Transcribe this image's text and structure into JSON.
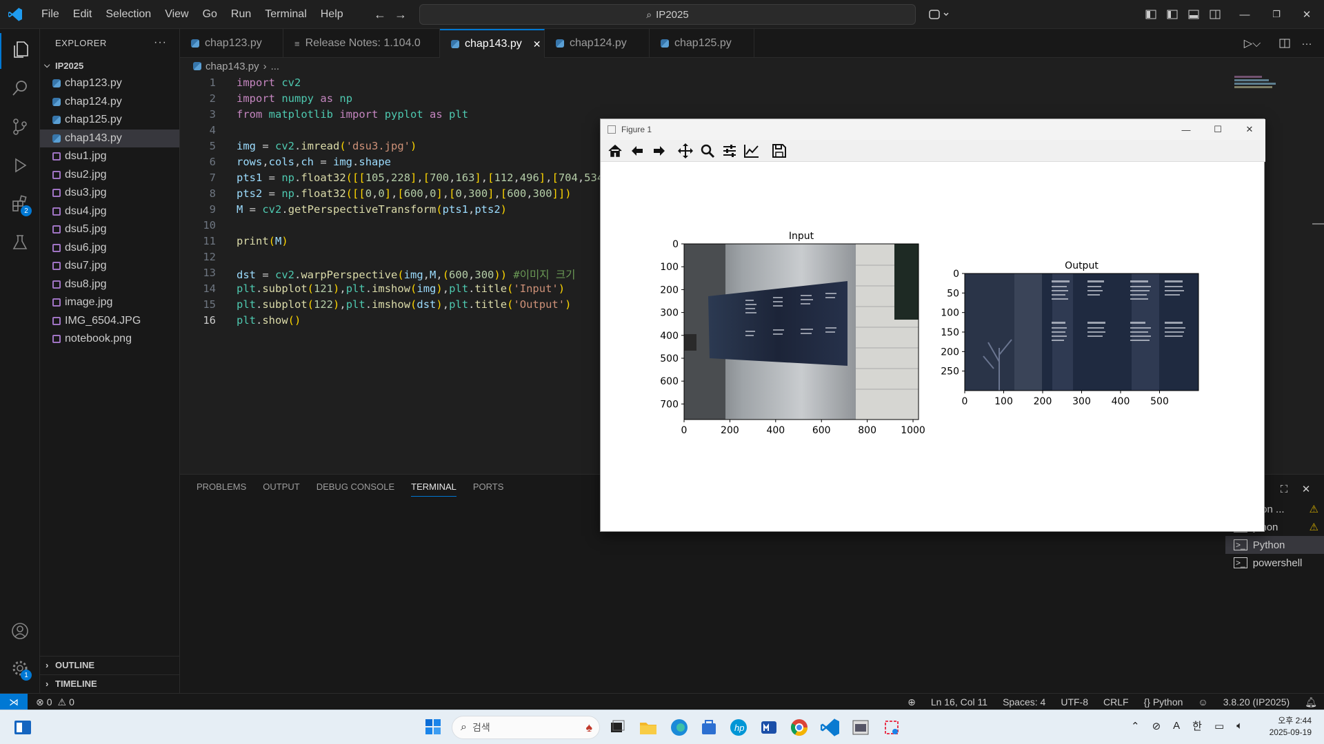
{
  "menu": {
    "items": [
      "File",
      "Edit",
      "Selection",
      "View",
      "Go",
      "Run",
      "Terminal",
      "Help"
    ]
  },
  "command_center": {
    "text": "IP2025"
  },
  "activity": {
    "extensions_badge": "2",
    "settings_badge": "1"
  },
  "explorer": {
    "title": "EXPLORER",
    "root": "IP2025",
    "files": [
      "chap123.py",
      "chap124.py",
      "chap125.py",
      "chap143.py",
      "dsu1.jpg",
      "dsu2.jpg",
      "dsu3.jpg",
      "dsu4.jpg",
      "dsu5.jpg",
      "dsu6.jpg",
      "dsu7.jpg",
      "dsu8.jpg",
      "image.jpg",
      "IMG_6504.JPG",
      "notebook.png"
    ],
    "outline": "OUTLINE",
    "timeline": "TIMELINE"
  },
  "tabs": [
    "chap123.py",
    "Release Notes: 1.104.0",
    "chap143.py",
    "chap124.py",
    "chap125.py"
  ],
  "breadcrumb": {
    "file": "chap143.py",
    "rest": "..."
  },
  "editor": {
    "line_numbers": [
      "1",
      "2",
      "3",
      "4",
      "5",
      "6",
      "7",
      "8",
      "9",
      "10",
      "11",
      "12",
      "13",
      "14",
      "15",
      "16"
    ],
    "lines": [
      "import cv2",
      "import numpy as np",
      "from matplotlib import pyplot as plt",
      "",
      "img = cv2.imread('dsu3.jpg')",
      "rows,cols,ch = img.shape",
      "pts1 = np.float32([[105,228],[700,163],[112,496],[704,534",
      "pts2 = np.float32([[0,0],[600,0],[0,300],[600,300]])",
      "M = cv2.getPerspectiveTransform(pts1,pts2)",
      "",
      "print(M)",
      "",
      "dst = cv2.warpPerspective(img,M,(600,300)) #이미지 크기",
      "plt.subplot(121),plt.imshow(img),plt.title('Input')",
      "plt.subplot(122),plt.imshow(dst),plt.title('Output')",
      "plt.show()"
    ]
  },
  "panel": {
    "tabs": [
      "PROBLEMS",
      "OUTPUT",
      "DEBUG CONSOLE",
      "TERMINAL",
      "PORTS"
    ],
    "terminals": [
      "Python",
      "Python",
      "Python",
      "powershell"
    ],
    "terminal_partial": [
      "thon ...",
      "ython"
    ]
  },
  "statusbar": {
    "errors": "0",
    "warnings": "0",
    "position": "Ln 16, Col 11",
    "spaces": "Spaces: 4",
    "encoding": "UTF-8",
    "eol": "CRLF",
    "language": "Python",
    "interpreter": "3.8.20 (IP2025)"
  },
  "figure": {
    "window_title": "Figure 1",
    "tools": [
      "home-icon",
      "back-icon",
      "forward-icon",
      "pan-icon",
      "zoom-icon",
      "configure-icon",
      "edit-axis-icon",
      "save-icon"
    ]
  },
  "chart_data": [
    {
      "type": "image",
      "title": "Input",
      "xticks": [
        "0",
        "200",
        "400",
        "600",
        "800",
        "1000"
      ],
      "yticks": [
        "0",
        "100",
        "200",
        "300",
        "400",
        "500",
        "600",
        "700"
      ],
      "xlim": [
        0,
        1024
      ],
      "ylim": [
        768,
        0
      ]
    },
    {
      "type": "image",
      "title": "Output",
      "xticks": [
        "0",
        "100",
        "200",
        "300",
        "400",
        "500"
      ],
      "yticks": [
        "0",
        "50",
        "100",
        "150",
        "200",
        "250"
      ],
      "xlim": [
        0,
        600
      ],
      "ylim": [
        300,
        0
      ]
    }
  ],
  "taskbar": {
    "search_placeholder": "검색",
    "time": "오후 2:44",
    "date": "2025-09-19",
    "ime_a": "A",
    "ime_han": "한"
  }
}
